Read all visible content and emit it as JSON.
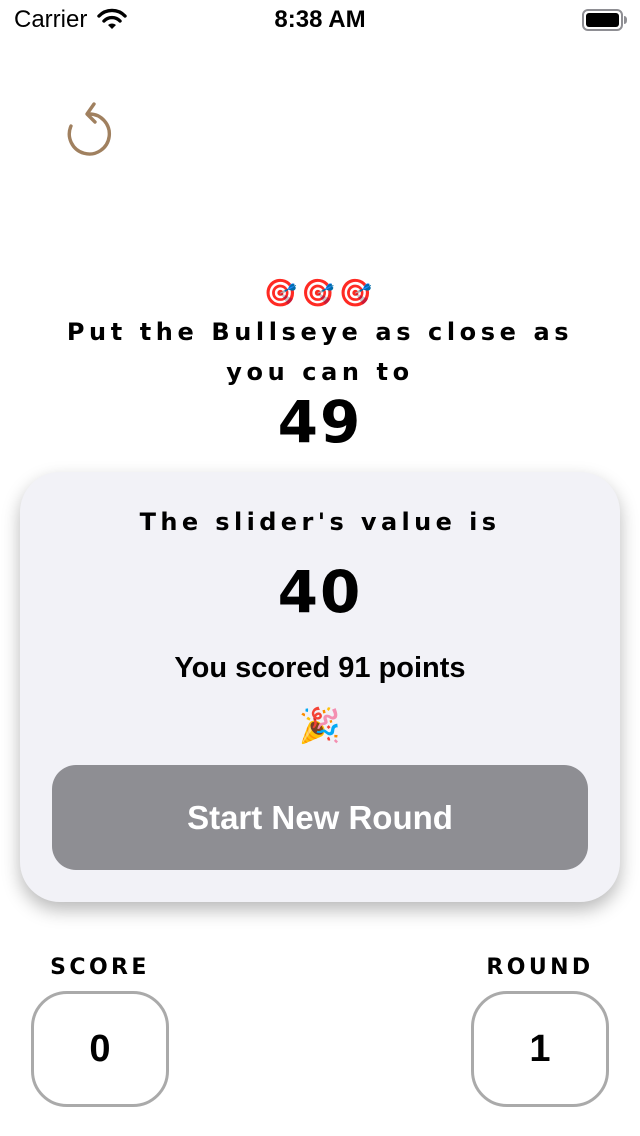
{
  "status_bar": {
    "carrier": "Carrier",
    "time": "8:38 AM",
    "wifi_icon": "wifi-icon",
    "battery_icon": "battery-icon"
  },
  "restart": {
    "icon": "restart-icon",
    "color": "#A0805F"
  },
  "instructions": {
    "emojis": "🎯🎯🎯",
    "text": "Put the Bullseye as close as you can to",
    "target_value": "49"
  },
  "result": {
    "slider_label": "The slider's value is",
    "slider_value": "40",
    "score_message": "You scored 91 points",
    "party_emoji": "🎉",
    "button_label": "Start New Round",
    "button_color": "#8E8E93",
    "card_background": "#F2F2F7"
  },
  "stats": {
    "score_label": "SCORE",
    "score_value": "0",
    "round_label": "ROUND",
    "round_value": "1"
  }
}
